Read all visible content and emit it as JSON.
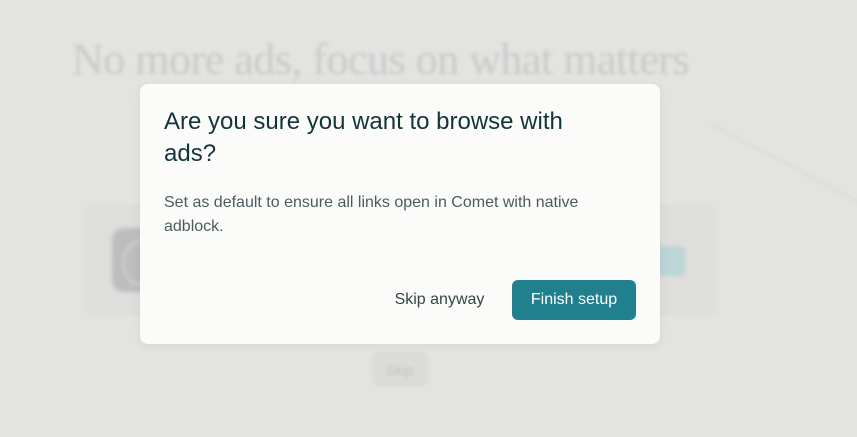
{
  "background": {
    "headline": "No more ads, focus on what matters",
    "skip_label": "Skip"
  },
  "dialog": {
    "title": "Are you sure you want to browse with ads?",
    "body": "Set as default to ensure all links open in Comet with native adblock.",
    "skip_button": "Skip anyway",
    "finish_button": "Finish setup"
  },
  "colors": {
    "accent": "#20808d",
    "title_text": "#13343b",
    "body_text": "#4d5b5e",
    "dialog_bg": "#fbfbf9",
    "backdrop": "#e3e3e1"
  }
}
